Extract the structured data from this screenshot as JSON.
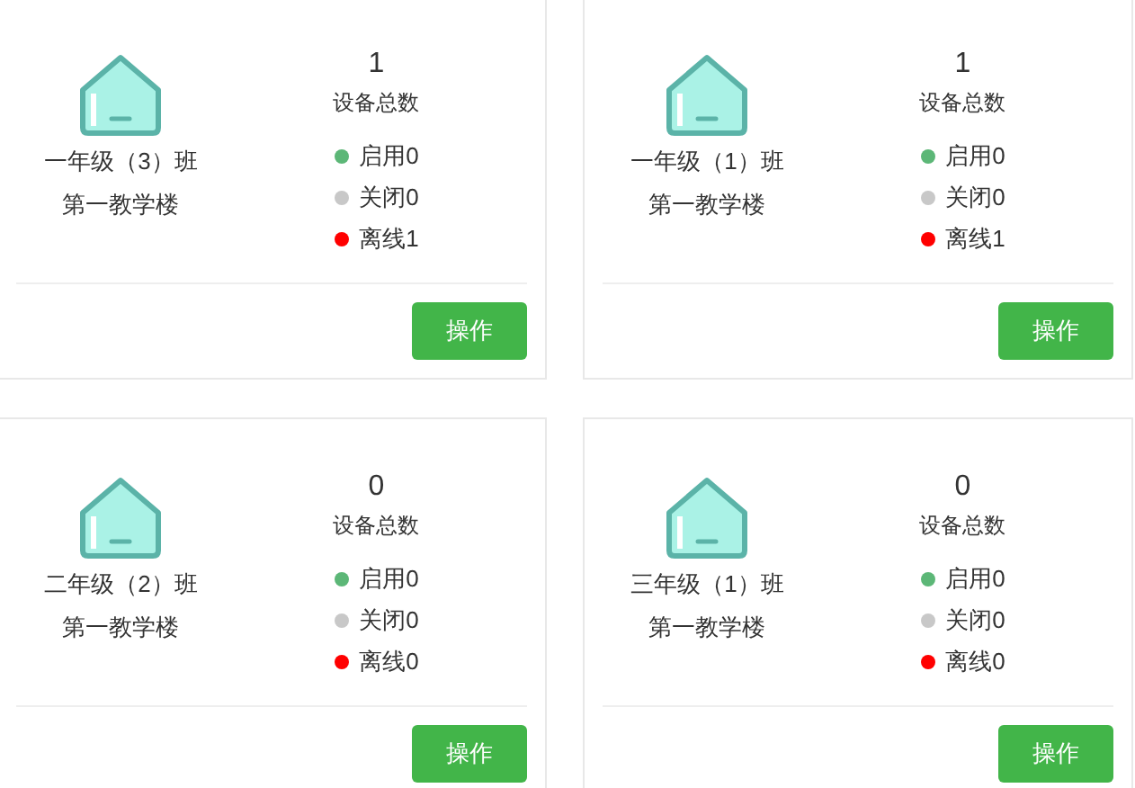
{
  "cards": [
    {
      "name": "一年级（3）班",
      "building": "第一教学楼",
      "count": "1",
      "count_label": "设备总数",
      "statuses": [
        {
          "label": "启用0",
          "color": "#5cb777"
        },
        {
          "label": "关闭0",
          "color": "#c8c8c8"
        },
        {
          "label": "离线1",
          "color": "#ff0000"
        }
      ],
      "button": "操作"
    },
    {
      "name": "一年级（1）班",
      "building": "第一教学楼",
      "count": "1",
      "count_label": "设备总数",
      "statuses": [
        {
          "label": "启用0",
          "color": "#5cb777"
        },
        {
          "label": "关闭0",
          "color": "#c8c8c8"
        },
        {
          "label": "离线1",
          "color": "#ff0000"
        }
      ],
      "button": "操作"
    },
    {
      "name": "二年级（2）班",
      "building": "第一教学楼",
      "count": "0",
      "count_label": "设备总数",
      "statuses": [
        {
          "label": "启用0",
          "color": "#5cb777"
        },
        {
          "label": "关闭0",
          "color": "#c8c8c8"
        },
        {
          "label": "离线0",
          "color": "#ff0000"
        }
      ],
      "button": "操作"
    },
    {
      "name": "三年级（1）班",
      "building": "第一教学楼",
      "count": "0",
      "count_label": "设备总数",
      "statuses": [
        {
          "label": "启用0",
          "color": "#5cb777"
        },
        {
          "label": "关闭0",
          "color": "#c8c8c8"
        },
        {
          "label": "离线0",
          "color": "#ff0000"
        }
      ],
      "button": "操作"
    }
  ]
}
